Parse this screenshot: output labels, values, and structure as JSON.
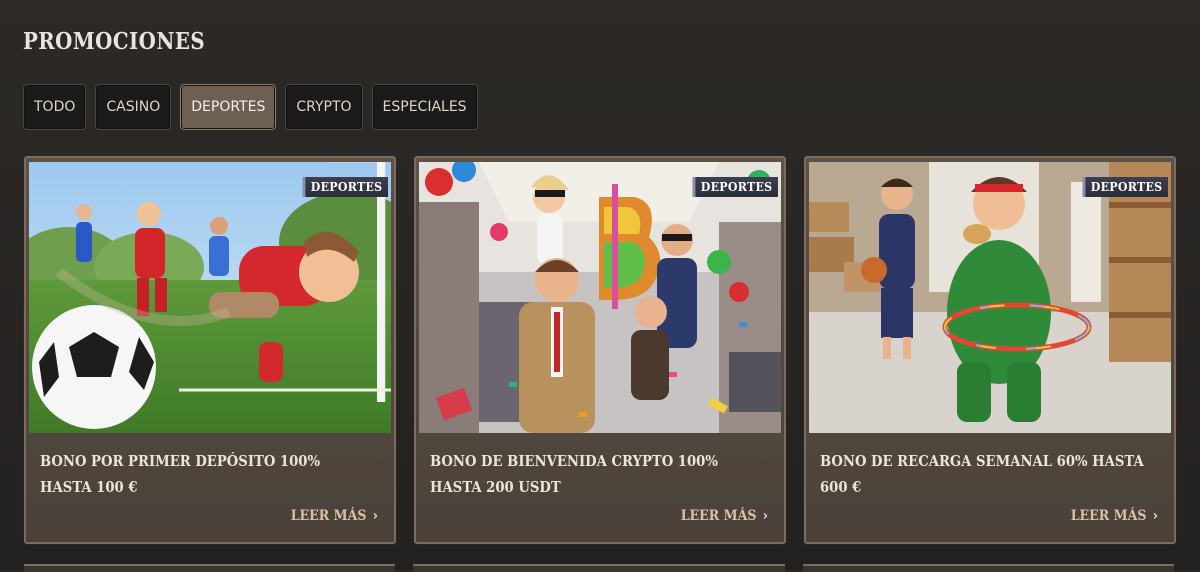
{
  "page": {
    "title": "PROMOCIONES"
  },
  "filters": [
    {
      "label": "TODO",
      "active": false
    },
    {
      "label": "CASINO",
      "active": false
    },
    {
      "label": "DEPORTES",
      "active": true
    },
    {
      "label": "CRYPTO",
      "active": false
    },
    {
      "label": "ESPECIALES",
      "active": false
    }
  ],
  "cards": [
    {
      "badge": "DEPORTES",
      "title": "BONO POR PRIMER DEPÓSITO 100% HASTA 100 €",
      "link": "LEER MÁS",
      "image": "soccer-players-illustration"
    },
    {
      "badge": "DEPORTES",
      "title": "BONO DE BIENVENIDA CRYPTO 100% HASTA 200 USDT",
      "link": "LEER MÁS",
      "image": "office-crypto-party-illustration"
    },
    {
      "badge": "DEPORTES",
      "title": "BONO DE RECARGA SEMANAL 60% HASTA 600 €",
      "link": "LEER MÁS",
      "image": "warehouse-hula-hoop-illustration"
    }
  ],
  "icons": {
    "read_more": "chevron-right-icon"
  },
  "colors": {
    "active_filter": "#6d5f52",
    "card_border": "#7b6c5f",
    "badge_bg": "#34374a"
  }
}
